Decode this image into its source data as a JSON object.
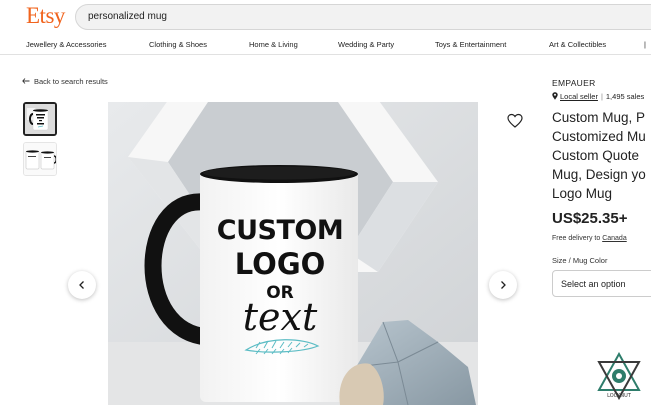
{
  "header": {
    "logo": "Etsy",
    "search_value": "personalized mug"
  },
  "categories": [
    "Jewellery & Accessories",
    "Clothing & Shoes",
    "Home & Living",
    "Wedding & Party",
    "Toys & Entertainment",
    "Art & Collectibles"
  ],
  "nav": {
    "back_label": "Back to search results"
  },
  "mug": {
    "line1": "CUSTOM",
    "line2": "LOGO",
    "line3": "OR",
    "line4": "text"
  },
  "listing": {
    "shop_name": "EMPAUER",
    "local_seller": "Local seller",
    "sales": "1,495 sales",
    "title_lines": [
      "Custom Mug, P",
      "Customized Mu",
      "Custom Quote",
      "Mug, Design yo",
      "Logo Mug"
    ],
    "price": "US$25.35+",
    "delivery_prefix": "Free delivery to ",
    "delivery_country": "Canada",
    "size_label": "Size / Mug Color",
    "select_placeholder": "Select an option"
  },
  "watermark": "LOCKNUT",
  "icons": {
    "back": "arrow-left-icon",
    "favorite": "heart-icon",
    "location": "map-pin-icon",
    "prev": "chevron-left-icon",
    "next": "chevron-right-icon"
  },
  "colors": {
    "brand": "#F1641E",
    "mug_leaf": "#5bbcc4"
  }
}
